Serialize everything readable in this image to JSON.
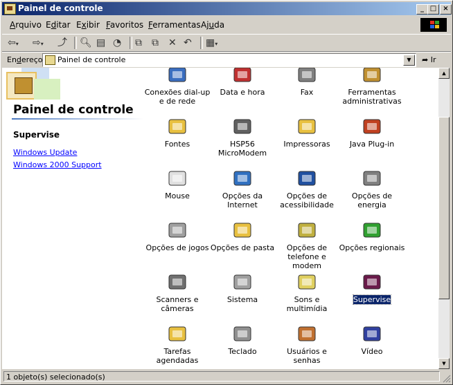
{
  "window": {
    "title": "Painel de controle"
  },
  "titlebar_buttons": {
    "minimize": "_",
    "maximize": "□",
    "close": "×"
  },
  "menu": [
    {
      "pre": "",
      "ul": "A",
      "post": "rquivo"
    },
    {
      "pre": "E",
      "ul": "d",
      "post": "itar"
    },
    {
      "pre": "E",
      "ul": "x",
      "post": "ibir"
    },
    {
      "pre": "",
      "ul": "F",
      "post": "avoritos"
    },
    {
      "pre": "",
      "ul": "F",
      "post": "erramentas"
    },
    {
      "pre": "Aj",
      "ul": "u",
      "post": "da"
    }
  ],
  "toolbar": {
    "back_icon": "back-arrow-icon",
    "forward_icon": "forward-arrow-icon",
    "up_icon": "up-folder-icon",
    "search_icon": "search-icon",
    "folders_icon": "folders-icon",
    "history_icon": "history-icon",
    "move_icon": "move-to-icon",
    "copy_icon": "copy-to-icon",
    "delete_icon": "delete-icon",
    "undo_icon": "undo-icon",
    "views_icon": "views-icon"
  },
  "address": {
    "label_pre": "En",
    "label_ul": "d",
    "label_post": "ereço",
    "value": "Painel de controle",
    "go_label": "Ir"
  },
  "left_pane": {
    "title": "Painel de controle",
    "selected_item": "Supervise",
    "links": [
      "Windows Update",
      "Windows 2000 Support"
    ]
  },
  "items": [
    {
      "lines": [
        "Conexões dial-up",
        "e de rede"
      ],
      "icon": "network-connections-icon",
      "color": "#3a6ec0"
    },
    {
      "lines": [
        "Data e hora"
      ],
      "icon": "date-time-icon",
      "color": "#c03030"
    },
    {
      "lines": [
        "Fax"
      ],
      "icon": "fax-icon",
      "color": "#808080"
    },
    {
      "lines": [
        "Ferramentas",
        "administrativas"
      ],
      "icon": "admin-tools-icon",
      "color": "#c09030"
    },
    {
      "lines": [
        "Fontes"
      ],
      "icon": "fonts-folder-icon",
      "color": "#e8c040"
    },
    {
      "lines": [
        "HSP56",
        "MicroModem"
      ],
      "icon": "modem-tools-icon",
      "color": "#606060"
    },
    {
      "lines": [
        "Impressoras"
      ],
      "icon": "printers-folder-icon",
      "color": "#e8c040"
    },
    {
      "lines": [
        "Java Plug-in"
      ],
      "icon": "java-icon",
      "color": "#c04020"
    },
    {
      "lines": [
        "Mouse"
      ],
      "icon": "mouse-icon",
      "color": "#e0e0e0"
    },
    {
      "lines": [
        "Opções da",
        "Internet"
      ],
      "icon": "internet-options-icon",
      "color": "#3070c0"
    },
    {
      "lines": [
        "Opções de",
        "acessibilidade"
      ],
      "icon": "accessibility-icon",
      "color": "#2050a0"
    },
    {
      "lines": [
        "Opções de energia"
      ],
      "icon": "power-options-icon",
      "color": "#808080"
    },
    {
      "lines": [
        "Opções de jogos"
      ],
      "icon": "game-controller-icon",
      "color": "#a0a0a0"
    },
    {
      "lines": [
        "Opções de pasta"
      ],
      "icon": "folder-options-icon",
      "color": "#e8c040"
    },
    {
      "lines": [
        "Opções de",
        "telefone e modem"
      ],
      "icon": "phone-modem-icon",
      "color": "#c0b040"
    },
    {
      "lines": [
        "Opções regionais"
      ],
      "icon": "globe-icon",
      "color": "#30a030"
    },
    {
      "lines": [
        "Scanners e",
        "câmeras"
      ],
      "icon": "scanner-camera-icon",
      "color": "#707070"
    },
    {
      "lines": [
        "Sistema"
      ],
      "icon": "computer-icon",
      "color": "#a0a0a0"
    },
    {
      "lines": [
        "Sons e multimídia"
      ],
      "icon": "speaker-icon",
      "color": "#e0d060"
    },
    {
      "lines": [
        "Supervise"
      ],
      "icon": "supervise-icon",
      "color": "#6a1a4a",
      "selected": true
    },
    {
      "lines": [
        "Tarefas",
        "agendadas"
      ],
      "icon": "scheduled-tasks-icon",
      "color": "#e8c040"
    },
    {
      "lines": [
        "Teclado"
      ],
      "icon": "keyboard-icon",
      "color": "#909090"
    },
    {
      "lines": [
        "Usuários e senhas"
      ],
      "icon": "users-passwords-icon",
      "color": "#c07030"
    },
    {
      "lines": [
        "Vídeo"
      ],
      "icon": "display-icon",
      "color": "#3040a0"
    }
  ],
  "status": {
    "text": "1 objeto(s) selecionado(s)"
  }
}
